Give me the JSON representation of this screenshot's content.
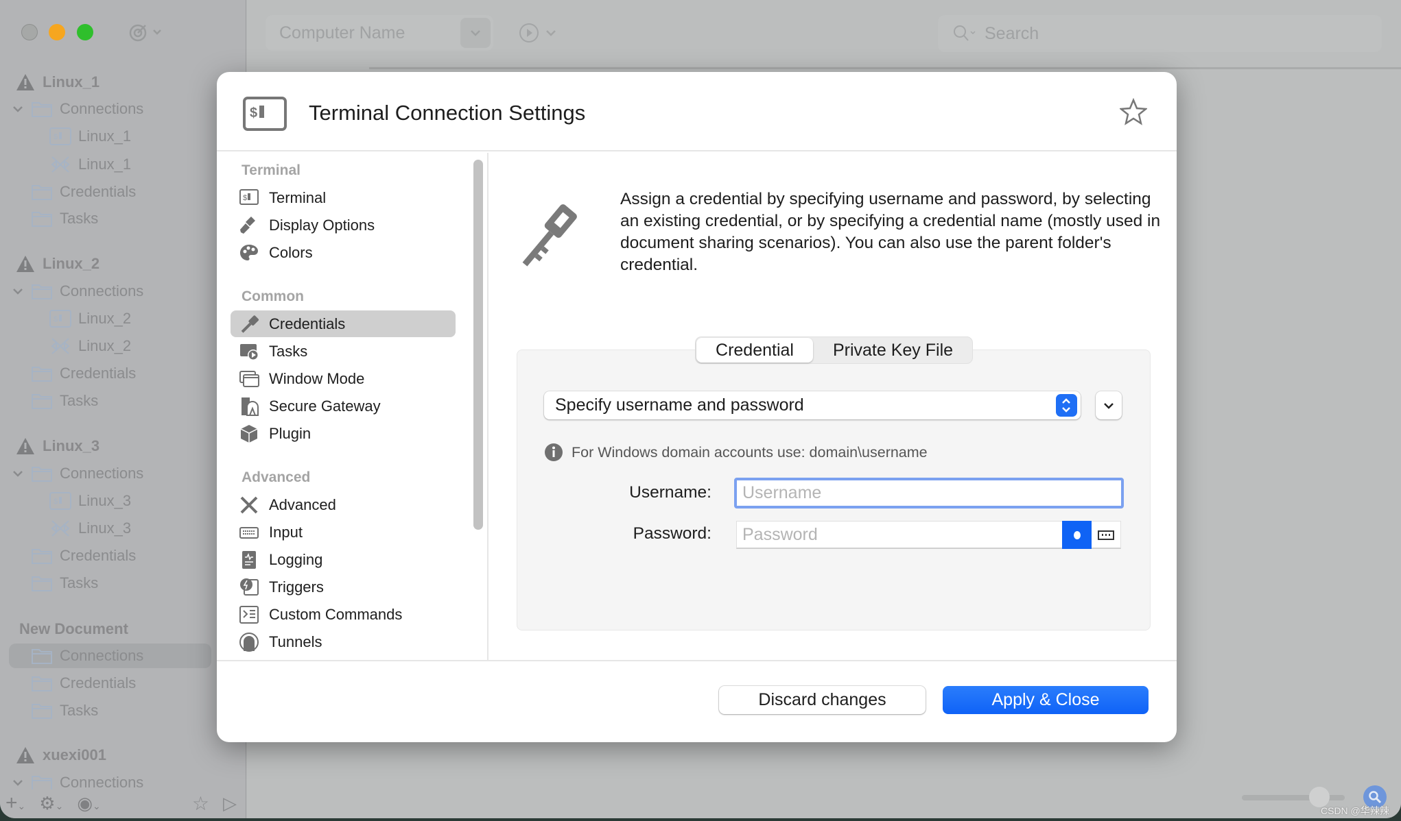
{
  "window": {
    "traffic_lights": {
      "close": "#a6a8a7",
      "minimize": "#f6a61f",
      "maximize": "#2fbf2c"
    },
    "toolbar": {
      "computer_name_placeholder": "Computer Name",
      "search_placeholder": "Search"
    },
    "sidebar_tree": [
      {
        "label": "Linux_1",
        "type": "document",
        "level": 0
      },
      {
        "label": "Connections",
        "type": "folder",
        "level": 1,
        "expanded": true
      },
      {
        "label": "Linux_1",
        "type": "terminal",
        "level": 2
      },
      {
        "label": "Linux_1",
        "type": "ssh",
        "level": 2
      },
      {
        "label": "Credentials",
        "type": "folder",
        "level": 1
      },
      {
        "label": "Tasks",
        "type": "folder",
        "level": 1
      },
      {
        "label": "Linux_2",
        "type": "document",
        "level": 0
      },
      {
        "label": "Connections",
        "type": "folder",
        "level": 1,
        "expanded": true
      },
      {
        "label": "Linux_2",
        "type": "terminal",
        "level": 2
      },
      {
        "label": "Linux_2",
        "type": "ssh",
        "level": 2
      },
      {
        "label": "Credentials",
        "type": "folder",
        "level": 1
      },
      {
        "label": "Tasks",
        "type": "folder",
        "level": 1
      },
      {
        "label": "Linux_3",
        "type": "document",
        "level": 0
      },
      {
        "label": "Connections",
        "type": "folder",
        "level": 1,
        "expanded": true
      },
      {
        "label": "Linux_3",
        "type": "terminal",
        "level": 2
      },
      {
        "label": "Linux_3",
        "type": "ssh",
        "level": 2
      },
      {
        "label": "Credentials",
        "type": "folder",
        "level": 1
      },
      {
        "label": "Tasks",
        "type": "folder",
        "level": 1
      },
      {
        "label": "New Document",
        "type": "header",
        "level": 0
      },
      {
        "label": "Connections",
        "type": "folder",
        "level": 1,
        "selected": true
      },
      {
        "label": "Credentials",
        "type": "folder",
        "level": 1
      },
      {
        "label": "Tasks",
        "type": "folder",
        "level": 1
      },
      {
        "label": "xuexi001",
        "type": "document",
        "level": 0
      },
      {
        "label": "Connections",
        "type": "folder",
        "level": 1,
        "expanded": true
      }
    ],
    "watermark": "CSDN @华辣辣"
  },
  "dialog": {
    "title": "Terminal Connection Settings",
    "nav": {
      "sections": [
        {
          "label": "Terminal",
          "items": [
            {
              "label": "Terminal",
              "icon": "terminal-icon"
            },
            {
              "label": "Display Options",
              "icon": "brush-icon"
            },
            {
              "label": "Colors",
              "icon": "palette-icon"
            }
          ]
        },
        {
          "label": "Common",
          "items": [
            {
              "label": "Credentials",
              "icon": "key-icon",
              "selected": true
            },
            {
              "label": "Tasks",
              "icon": "tasks-icon"
            },
            {
              "label": "Window Mode",
              "icon": "window-icon"
            },
            {
              "label": "Secure Gateway",
              "icon": "gateway-icon"
            },
            {
              "label": "Plugin",
              "icon": "plugin-icon"
            }
          ]
        },
        {
          "label": "Advanced",
          "items": [
            {
              "label": "Advanced",
              "icon": "tools-icon"
            },
            {
              "label": "Input",
              "icon": "keyboard-icon"
            },
            {
              "label": "Logging",
              "icon": "logging-icon"
            },
            {
              "label": "Triggers",
              "icon": "triggers-icon"
            },
            {
              "label": "Custom Commands",
              "icon": "commands-icon"
            },
            {
              "label": "Tunnels",
              "icon": "tunnel-icon"
            }
          ]
        }
      ]
    },
    "description": "Assign a credential by specifying username and password, by selecting an existing credential, or by specifying a credential name (mostly used in document sharing scenarios). You can also use the parent folder's credential.",
    "tabs": [
      {
        "label": "Credential",
        "active": true
      },
      {
        "label": "Private Key File",
        "active": false
      }
    ],
    "credential_mode": "Specify username and password",
    "info": "For Windows domain accounts use: domain\\username",
    "username_label": "Username:",
    "username_placeholder": "Username",
    "password_label": "Password:",
    "password_placeholder": "Password",
    "discard_label": "Discard changes",
    "apply_label": "Apply & Close",
    "accent": "#1a6dfb"
  }
}
